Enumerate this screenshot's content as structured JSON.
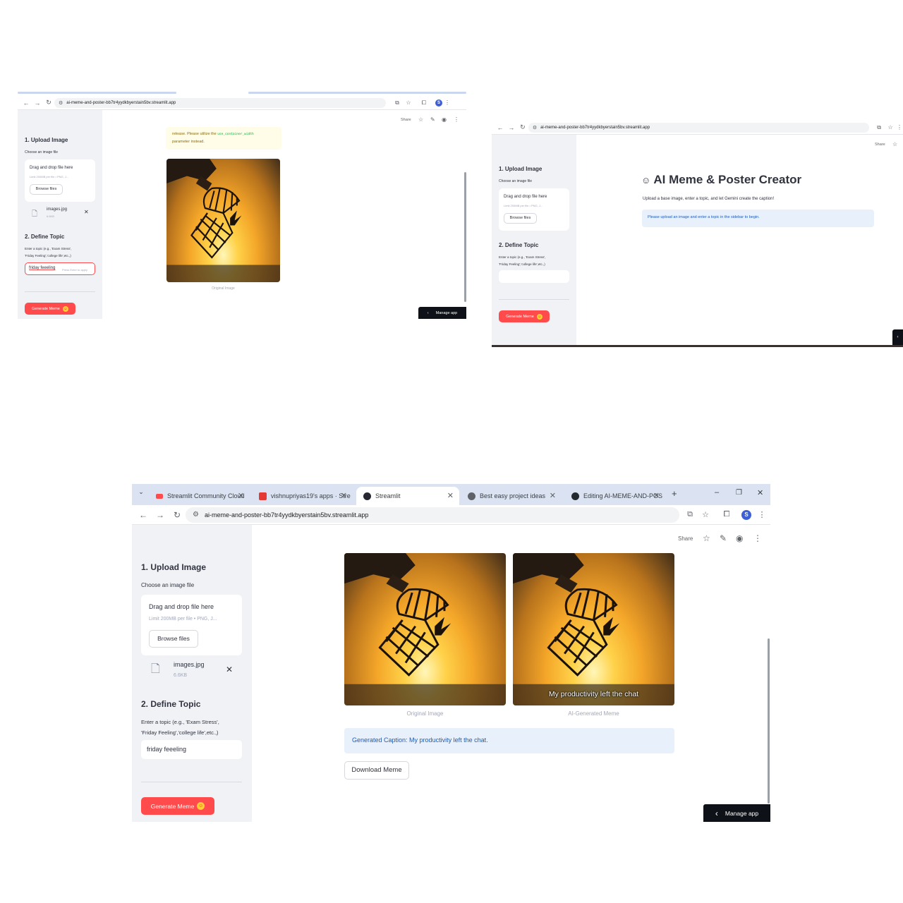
{
  "browser": {
    "url": "ai-meme-and-poster-bb7tr4yydkbyerstain5bv.streamlit.app",
    "tabs": [
      {
        "title": "Streamlit Community Cloud",
        "active": false
      },
      {
        "title": "vishnupriyas19's apps · Stre",
        "active": false
      },
      {
        "title": "Streamlit",
        "active": true
      },
      {
        "title": "Best easy project ideas",
        "active": false
      },
      {
        "title": "Editing AI-MEME-AND-POS",
        "active": false
      }
    ],
    "avatar_letter": "S",
    "new_tab": "+"
  },
  "toolbar": {
    "share": "Share"
  },
  "sidebar": {
    "upload_heading": "1. Upload Image",
    "upload_label": "Choose an image file",
    "dropzone_title": "Drag and drop file here",
    "dropzone_limit": "Limit 200MB per file • PNG, J...",
    "browse_button": "Browse files",
    "file_name": "images.jpg",
    "file_size": "6.6KB",
    "topic_heading": "2. Define Topic",
    "topic_hint_line1": "Enter a topic (e.g., 'Exam Stress',",
    "topic_hint_line2": "'Friday Feeling','college life',etc.,)",
    "topic_value": "friday feeeling",
    "press_enter": "Press Enter to apply",
    "generate_button": "Generate Meme"
  },
  "screen1": {
    "warning_line1": "release. Please utilize the",
    "warning_code": "use_container_width",
    "warning_line2": "parameter instead.",
    "image_caption": "Original Image"
  },
  "screen2": {
    "title": "AI Meme & Poster Creator",
    "subtitle": "Upload a base image, enter a topic, and let Gemini create the caption!",
    "info": "Please upload an image and enter a topic in the sidebar to begin."
  },
  "screen3": {
    "original_caption": "Original Image",
    "generated_caption": "AI-Generated Meme",
    "meme_text": "My productivity left the chat",
    "generated_info": "Generated Caption: My productivity left the chat.",
    "download_button": "Download Meme"
  },
  "manage_app": "Manage app",
  "colors": {
    "primary": "#ff4b4b",
    "sidebar": "#f0f2f6",
    "info_bg": "#e8f0fc",
    "info_text": "#1c5bb5",
    "warning_bg": "#fffce8"
  }
}
